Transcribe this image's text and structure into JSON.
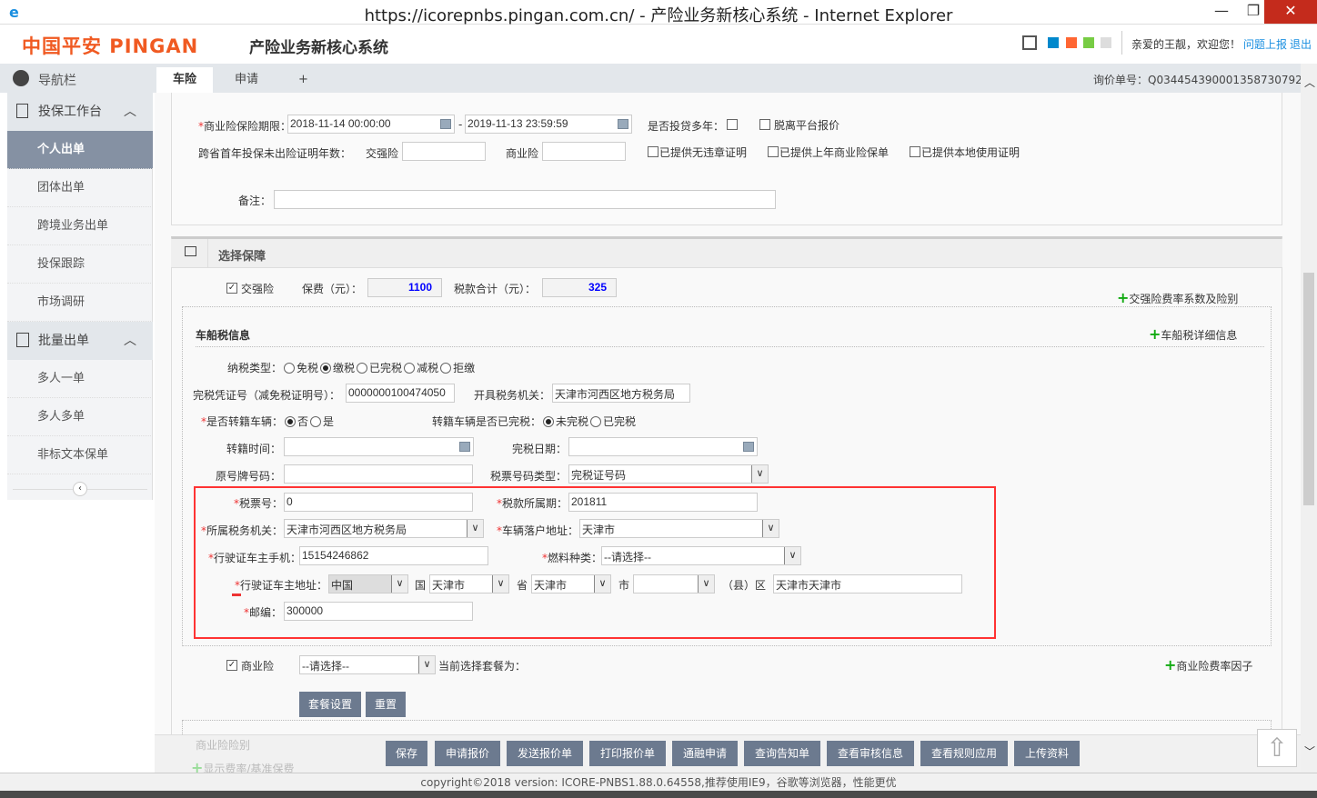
{
  "window": {
    "title": "https://icorepnbs.pingan.com.cn/ - 产险业务新核心系统 - Internet Explorer",
    "min": "—",
    "max": "❐",
    "close": "✕"
  },
  "header": {
    "logo": "中国平安 PINGAN",
    "system": "产险业务新核心系统",
    "greeting": "亲爱的王靓，欢迎您！",
    "report": "问题上报",
    "logout": "退出",
    "colors": [
      "#0088cc",
      "#ff6633",
      "#77cc44",
      "#dddddd"
    ]
  },
  "nav": {
    "label": "导航栏",
    "tabs": [
      "车险",
      "申请",
      "+"
    ],
    "inquiry": "询价单号：Q034454390001358730792"
  },
  "sidebar": {
    "groups": [
      {
        "label": "投保工作台",
        "items": [
          "个人出单",
          "团体出单",
          "跨境业务出单",
          "投保跟踪",
          "市场调研"
        ]
      },
      {
        "label": "批量出单",
        "items": [
          "多人一单",
          "多人多单",
          "非标文本保单"
        ]
      }
    ]
  },
  "top": {
    "period_label": "商业险保险期限：",
    "start": "2018-11-14 00:00:00",
    "end": "2019-11-13 23:59:59",
    "multi_year": "是否投贷多年：",
    "offline": "脱离平台报价",
    "cross_label": "跨省首年投保未出险证明年数：",
    "jq": "交强险",
    "sy": "商业险",
    "c1": "已提供无违章证明",
    "c2": "已提供上年商业险保单",
    "c3": "已提供本地使用证明",
    "remark": "备注："
  },
  "coverage": {
    "title": "选择保障",
    "jq": "交强险",
    "premium_label": "保费（元）：",
    "premium": "1100",
    "tax_label": "税款合计（元）：",
    "tax": "325",
    "jq_link": "交强险费率系数及险别"
  },
  "tax": {
    "title": "车船税信息",
    "detail_link": "车船税详细信息",
    "type_label": "纳税类型：",
    "types": [
      "免税",
      "缴税",
      "已完税",
      "减税",
      "拒缴"
    ],
    "cert_label": "完税凭证号（减免税证明号）：",
    "cert": "0000000100474050",
    "office_label": "开具税务机关：",
    "office": "天津市河西区地方税务局",
    "transfer_label": "是否转籍车辆：",
    "no": "否",
    "yes": "是",
    "transfer_paid_label": "转籍车辆是否已完税：",
    "unpaid": "未完税",
    "paid": "已完税",
    "transfer_time": "转籍时间：",
    "paid_date": "完税日期：",
    "orig_plate": "原号牌号码：",
    "ticket_type": "税票号码类型：",
    "ticket_type_val": "完税证号码",
    "ticket_no_label": "税票号：",
    "ticket_no": "0",
    "period_label": "税款所属期：",
    "period": "201811",
    "auth_label": "所属税务机关：",
    "auth": "天津市河西区地方税务局",
    "reg_label": "车辆落户地址：",
    "reg": "天津市",
    "phone_label": "行驶证车主手机：",
    "phone": "15154246862",
    "fuel_label": "燃料种类：",
    "fuel": "--请选择--",
    "addr_label": "行驶证车主地址：",
    "country": "中国",
    "u_country": "国",
    "prov": "天津市",
    "u_prov": "省",
    "city": "天津市",
    "u_city": "市",
    "county": "",
    "u_county": "（县）区",
    "addr": "天津市天津市",
    "zip_label": "邮编：",
    "zip": "300000"
  },
  "commercial": {
    "label": "商业险",
    "plan": "--请选择--",
    "current": "当前选择套餐为：",
    "link": "商业险费率因子",
    "set": "套餐设置",
    "reset": "重置",
    "kinds": "商业险险别",
    "show_rates": "显示费率/基准保费"
  },
  "actions": [
    "保存",
    "申请报价",
    "发送报价单",
    "打印报价单",
    "通融申请",
    "查询告知单",
    "查看审核信息",
    "查看规则应用",
    "上传资料"
  ],
  "footer": {
    "copyright": "copyright©2018 version: ICORE-PNBS1.88.0.64558,推荐使用IE9，谷歌等浏览器，性能更优"
  }
}
